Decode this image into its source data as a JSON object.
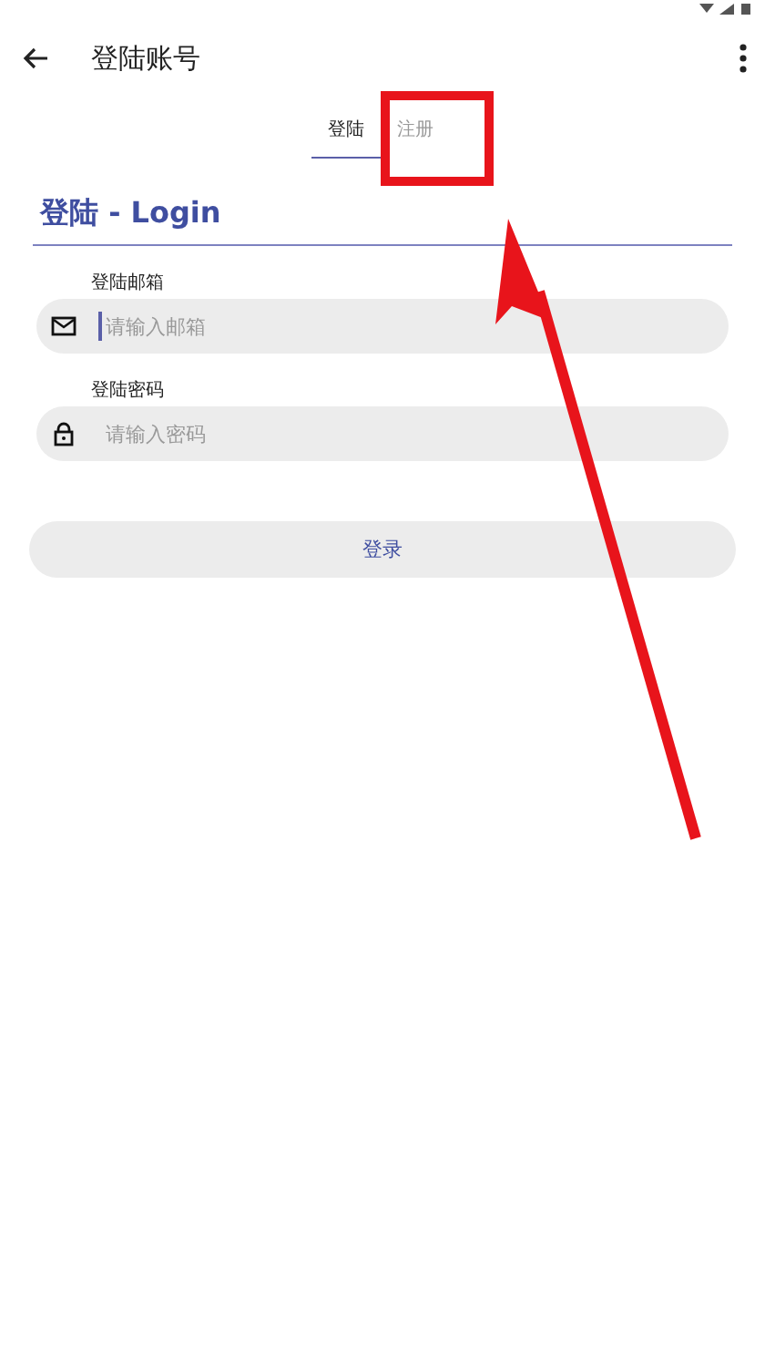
{
  "toolbar": {
    "title": "登陆账号"
  },
  "tabs": [
    {
      "label": "登陆",
      "selected": true
    },
    {
      "label": "注册",
      "selected": false
    }
  ],
  "form": {
    "heading": "登陆 - Login",
    "fields": [
      {
        "label": "登陆邮箱",
        "kind": "email",
        "placeholder": "请输入邮箱",
        "focused": true
      },
      {
        "label": "登陆密码",
        "kind": "password",
        "placeholder": "请输入密码",
        "focused": false
      }
    ],
    "submit": "登录"
  }
}
